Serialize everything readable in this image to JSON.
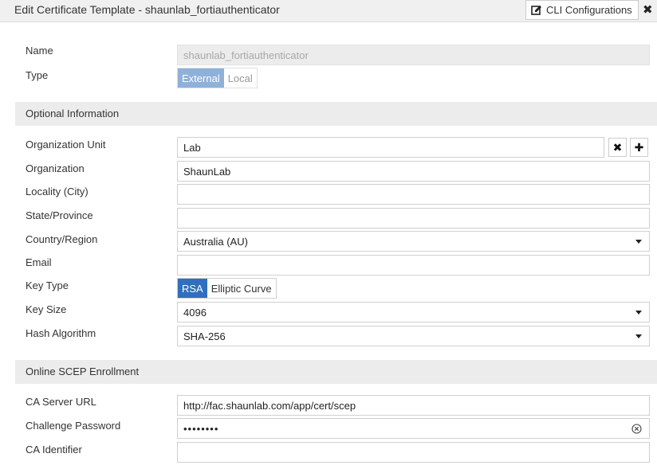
{
  "window": {
    "title": "Edit Certificate Template - shaunlab_fortiauthenticator",
    "cli_button_label": "CLI Configurations",
    "close_icon": "close-icon"
  },
  "general": {
    "name_label": "Name",
    "name_value": "shaunlab_fortiauthenticator",
    "type_label": "Type",
    "type_options": [
      "External",
      "Local"
    ],
    "type_selected": "External"
  },
  "optional": {
    "section_title": "Optional Information",
    "org_unit_label": "Organization Unit",
    "org_unit_value": "Lab",
    "organization_label": "Organization",
    "organization_value": "ShaunLab",
    "locality_label": "Locality (City)",
    "locality_value": "",
    "state_label": "State/Province",
    "state_value": "",
    "country_label": "Country/Region",
    "country_value": "Australia (AU)",
    "email_label": "Email",
    "email_value": "",
    "key_type_label": "Key Type",
    "key_type_options": [
      "RSA",
      "Elliptic Curve"
    ],
    "key_type_selected": "RSA",
    "key_size_label": "Key Size",
    "key_size_value": "4096",
    "hash_label": "Hash Algorithm",
    "hash_value": "SHA-256"
  },
  "scep": {
    "section_title": "Online SCEP Enrollment",
    "ca_url_label": "CA Server URL",
    "ca_url_value": "http://fac.shaunlab.com/app/cert/scep",
    "challenge_label": "Challenge Password",
    "challenge_value": "••••••••",
    "ca_identifier_label": "CA Identifier",
    "ca_identifier_value": ""
  },
  "colors": {
    "accent": "#2f6fbd",
    "accent_muted": "#8fb0d9",
    "section_bg": "#ececec"
  }
}
